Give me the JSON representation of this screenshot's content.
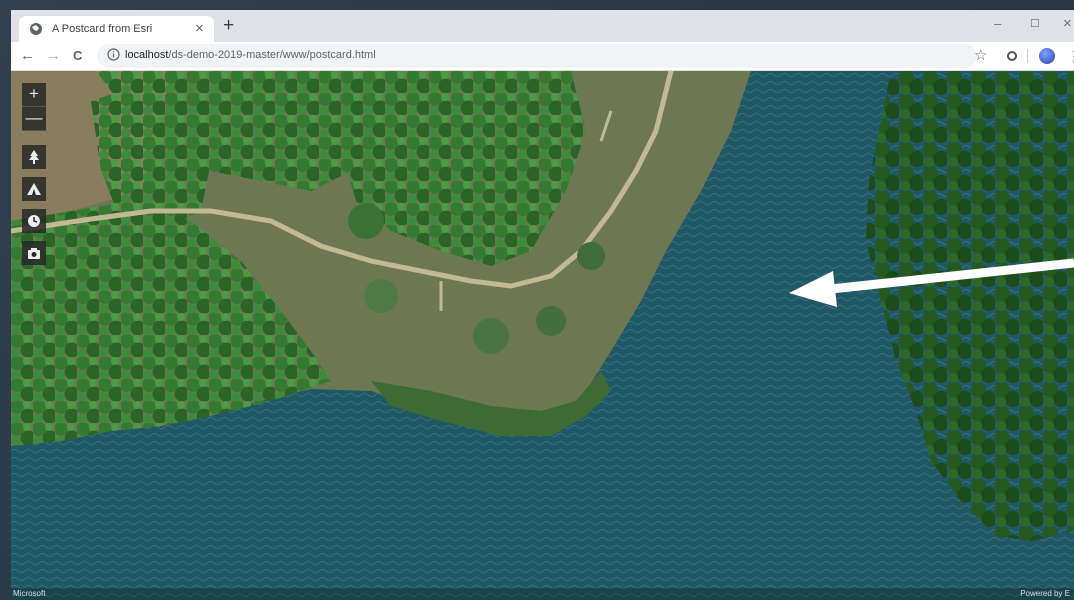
{
  "browser": {
    "tab_title": "A Postcard from Esri",
    "tab_close": "×",
    "new_tab": "+",
    "window_minimize": "–",
    "window_maximize": "☐",
    "window_close": "×",
    "back": "←",
    "forward": "→",
    "reload": "C",
    "url_host": "localhost",
    "url_path": "/ds-demo-2019-master/www/postcard.html",
    "bookmark_star": "☆",
    "menu": "⋮"
  },
  "map": {
    "zoom_in_label": "+",
    "zoom_out_label": "—",
    "tools": [
      "tree-tool",
      "camping-tool",
      "clock-tool",
      "camera-tool"
    ],
    "attribution_left": "Microsoft",
    "attribution_right": "Powered by E",
    "colors": {
      "water": "#205866",
      "forest": "#2f6a2a",
      "meadow": "#6f7a55",
      "road": "#c3b894",
      "arrow": "#ffffff"
    }
  }
}
